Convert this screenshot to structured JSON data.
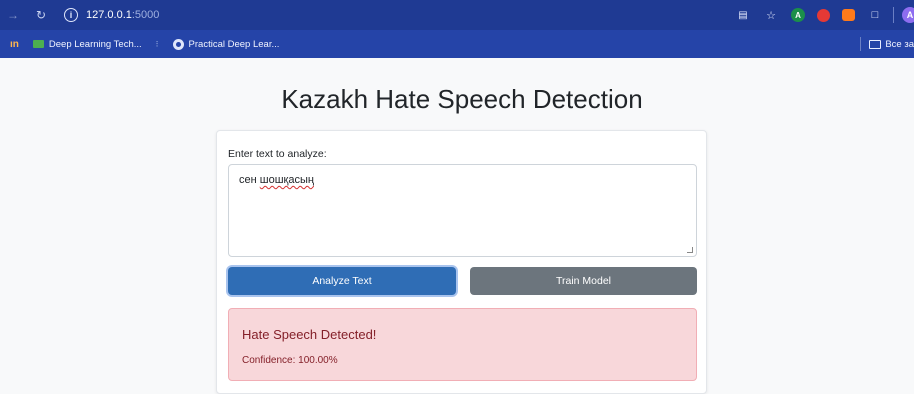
{
  "browser": {
    "url_host": "127.0.0.1",
    "url_port": ":5000",
    "profile_initial": "A",
    "ext_a_initial": "A"
  },
  "bookmarks": {
    "apps_label": "ın",
    "items": [
      {
        "label": "Deep Learning Tech..."
      },
      {
        "label": "Practical Deep Lear..."
      }
    ],
    "all_bookmarks_label": "Все за"
  },
  "page": {
    "title": "Kazakh Hate Speech Detection",
    "input_label": "Enter text to analyze:",
    "input_word1": "сен",
    "input_word2": "шошқасың",
    "analyze_button": "Analyze Text",
    "train_button": "Train Model",
    "result_title": "Hate Speech Detected!",
    "result_confidence": "Confidence: 100.00%"
  },
  "colors": {
    "topbar": "#1f3a93",
    "bookmarks_bar": "#2544a8",
    "analyze_button": "#2f6db5",
    "train_button": "#6c757d",
    "alert_bg": "#f8d7da",
    "alert_text": "#842029"
  }
}
